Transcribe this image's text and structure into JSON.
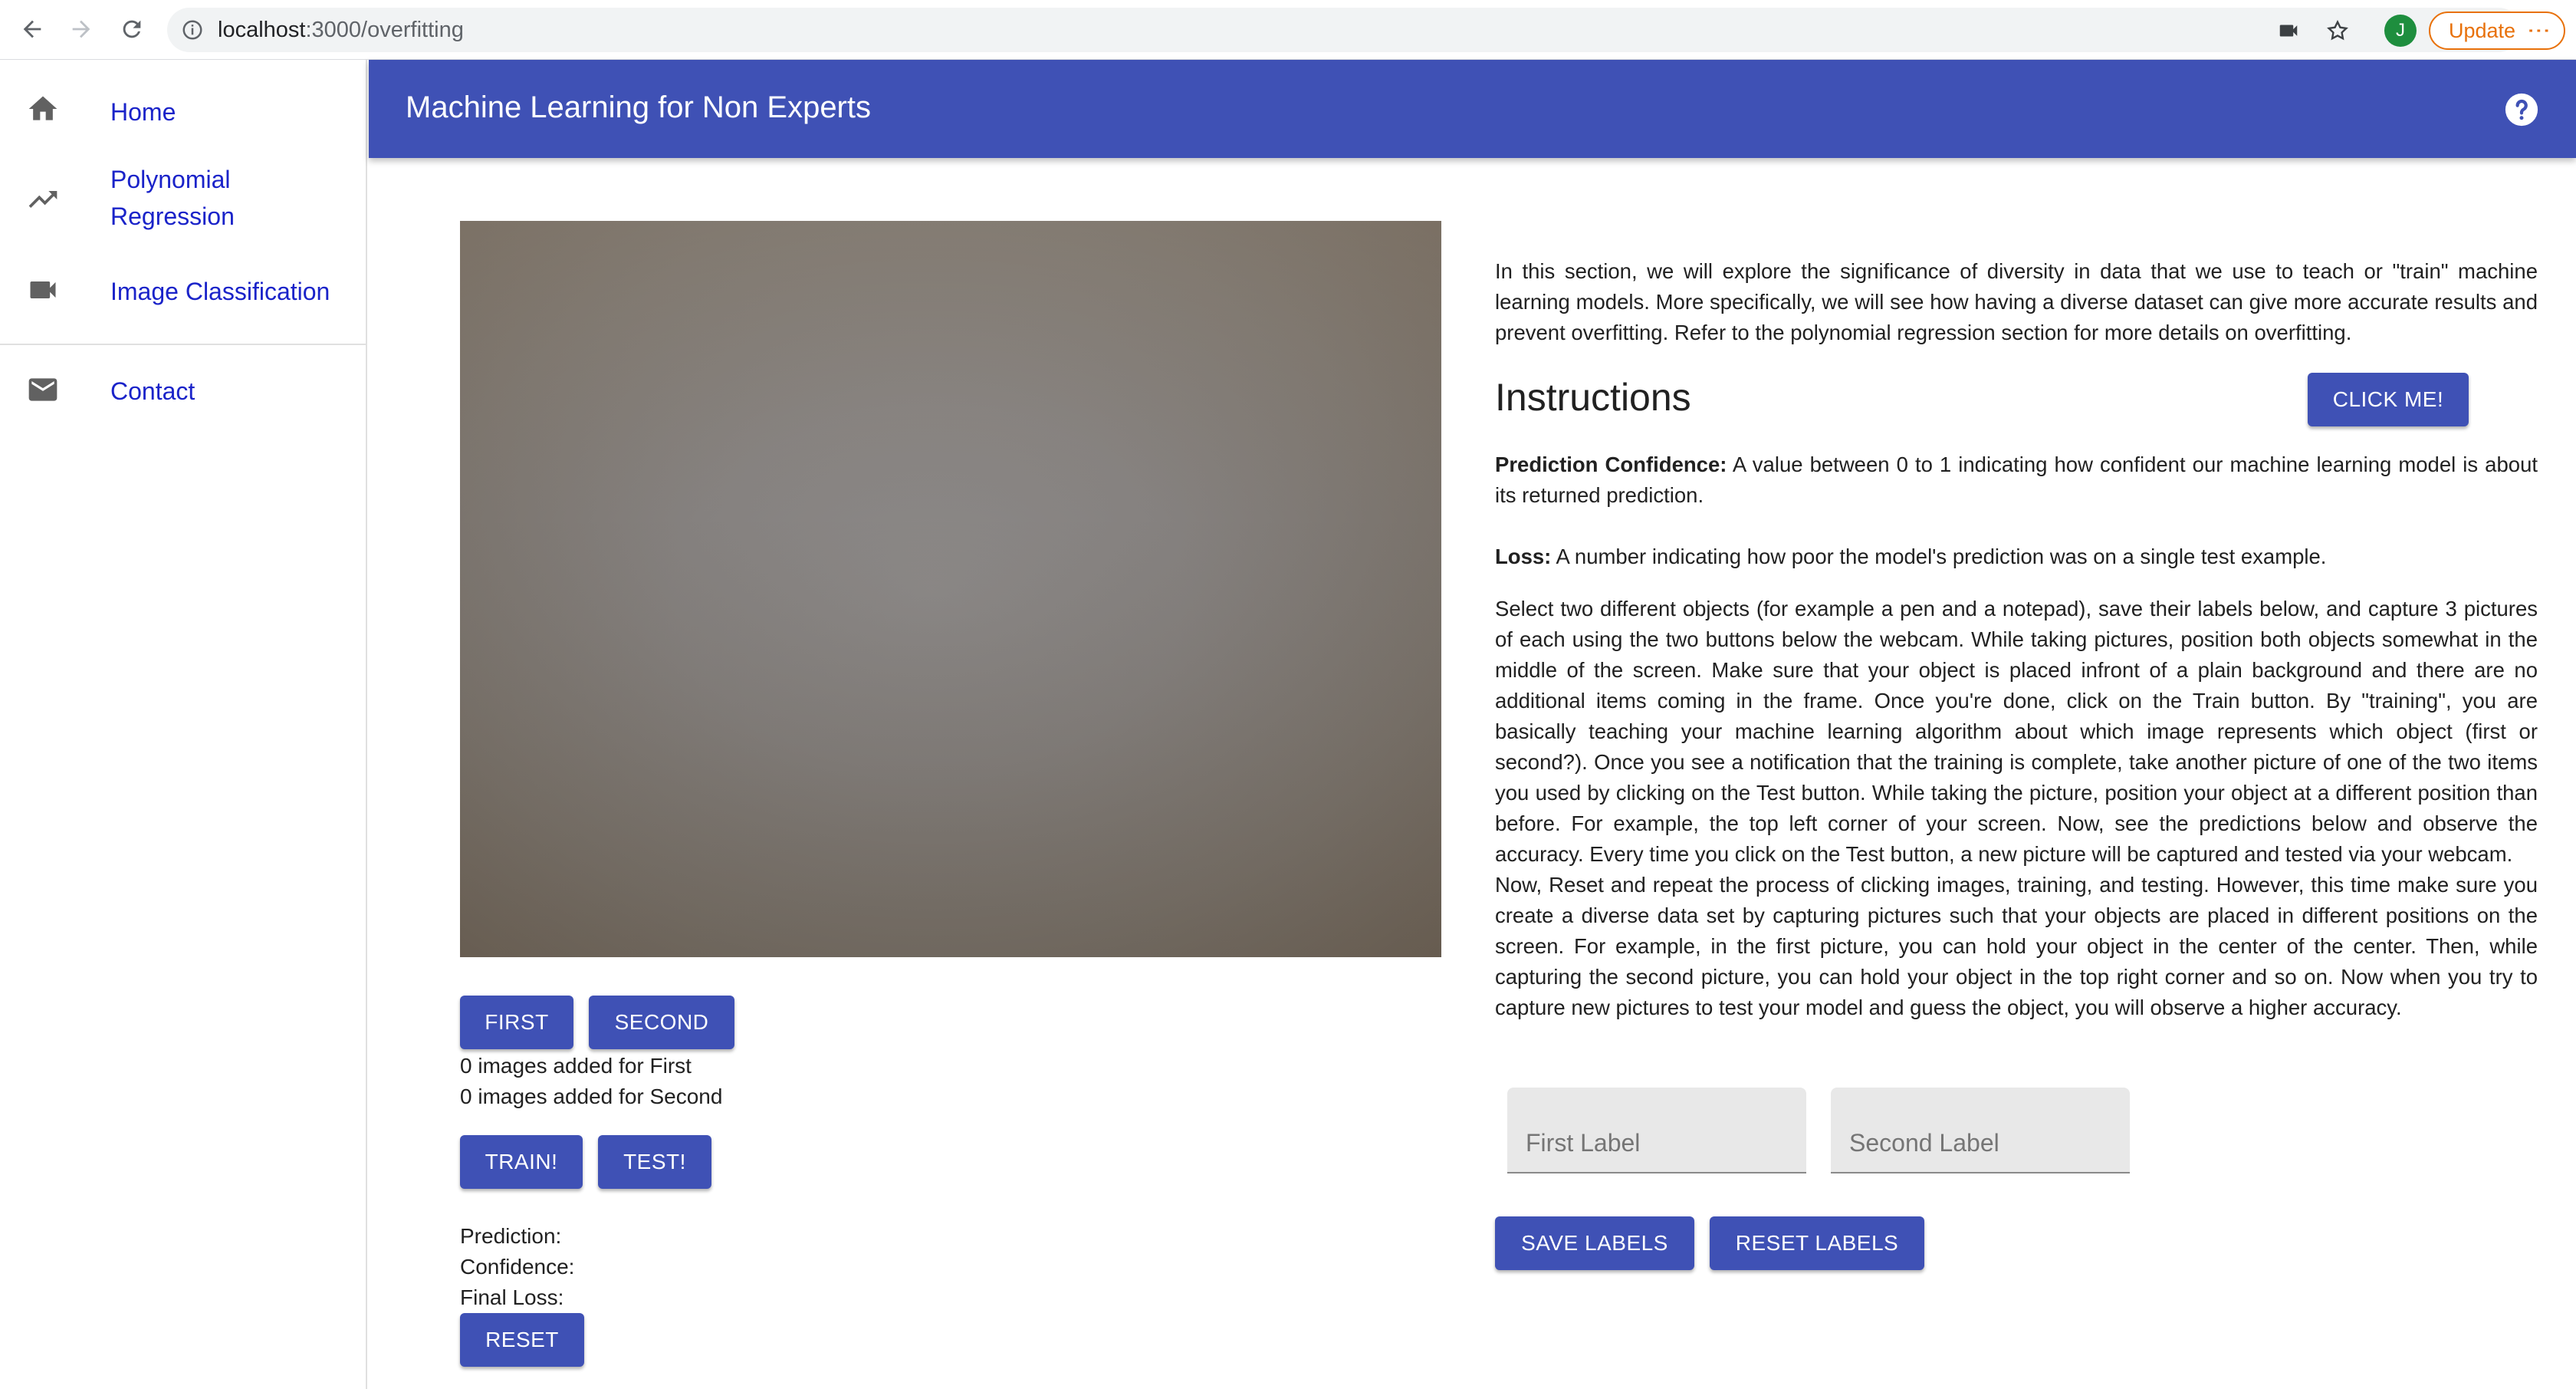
{
  "browser": {
    "url_host": "localhost",
    "url_path": ":3000/overfitting",
    "profile_initial": "J",
    "update_label": "Update"
  },
  "sidebar": {
    "items": [
      {
        "label": "Home",
        "icon": "home-icon"
      },
      {
        "label": "Polynomial Regression",
        "icon": "trending-up-icon"
      },
      {
        "label": "Image Classification",
        "icon": "videocam-icon"
      },
      {
        "label": "Contact",
        "icon": "mail-icon"
      }
    ]
  },
  "appbar": {
    "title": "Machine Learning for Non Experts",
    "accent_color": "#3f51b5"
  },
  "controls": {
    "first_label": "FIRST",
    "second_label": "SECOND",
    "first_count": "0 images added for First",
    "second_count": "0 images added for Second",
    "train_label": "TRAIN!",
    "test_label": "TEST!",
    "prediction_label": "Prediction:",
    "confidence_label": "Confidence:",
    "final_loss_label": "Final Loss:",
    "reset_label": "RESET"
  },
  "content": {
    "intro": "In this section, we will explore the significance of diversity in data that we use to teach or \"train\" machine learning models. More specifically, we will see how having a diverse dataset can give more accurate results and prevent overfitting. Refer to the polynomial regression section for more details on overfitting.",
    "instructions_title": "Instructions",
    "click_me_label": "CLICK ME!",
    "prediction_confidence_term": "Prediction Confidence:",
    "prediction_confidence_def": " A value between 0 to 1 indicating how confident our machine learning model is about its returned prediction.",
    "loss_term": "Loss:",
    "loss_def": " A number indicating how poor the model's prediction was on a single test example.",
    "paragraph1": "Select two different objects (for example a pen and a notepad), save their labels below, and capture 3 pictures of each using the two buttons below the webcam. While taking pictures, position both objects somewhat in the middle of the screen. Make sure that your object is placed infront of a plain background and there are no additional items coming in the frame. Once you're done, click on the Train button. By \"training\", you are basically teaching your machine learning algorithm about which image represents which object (first or second?). Once you see a notification that the training is complete, take another picture of one of the two items you used by clicking on the Test button. While taking the picture, position your object at a different position than before. For example, the top left corner of your screen. Now, see the predictions below and observe the accuracy. Every time you click on the Test button, a new picture will be captured and tested via your webcam.",
    "paragraph2": "Now, Reset and repeat the process of clicking images, training, and testing. However, this time make sure you create a diverse data set by capturing pictures such that your objects are placed in different positions on the screen. For example, in the first picture, you can hold your object in the center of the center. Then, while capturing the second picture, you can hold your object in the top right corner and so on. Now when you try to capture new pictures to test your model and guess the object, you will observe a higher accuracy."
  },
  "labels_form": {
    "first_placeholder": "First Label",
    "second_placeholder": "Second Label",
    "save_label": "SAVE LABELS",
    "reset_label": "RESET LABELS"
  }
}
